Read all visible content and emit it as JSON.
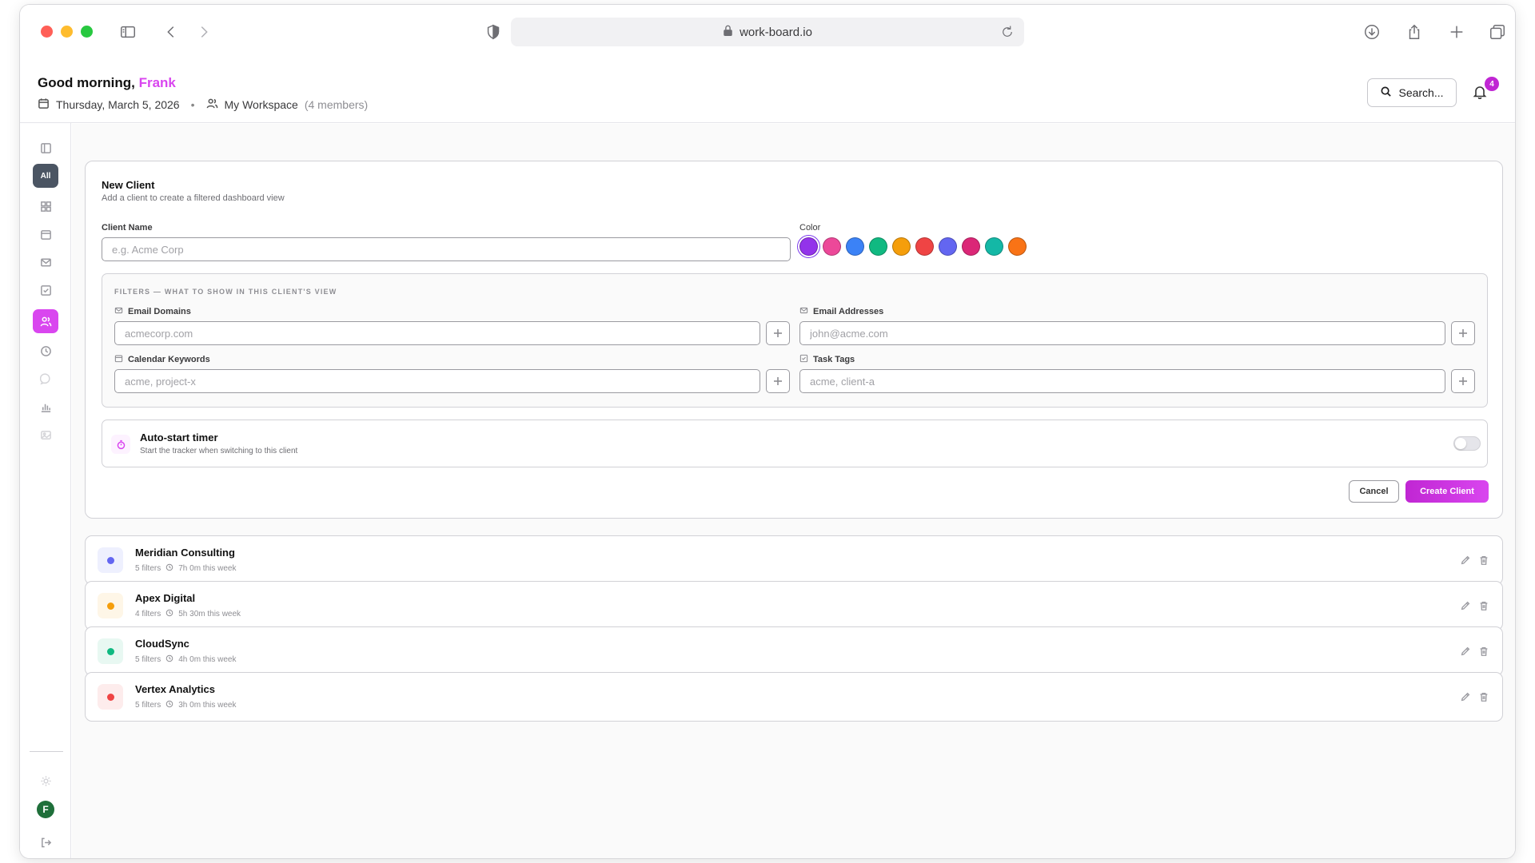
{
  "browser": {
    "url": "work-board.io"
  },
  "header": {
    "greeting": "Good morning,",
    "user_name": "Frank",
    "date": "Thursday, March 5, 2026",
    "separator": "•",
    "workspace": "My Workspace",
    "members": "(4 members)",
    "search_label": "Search...",
    "notification_count": "4"
  },
  "sidebar": {
    "all_label": "All",
    "avatar_initial": "F"
  },
  "new_client": {
    "title": "New Client",
    "subtitle": "Add a client to create a filtered dashboard view",
    "client_name_label": "Client Name",
    "client_name_placeholder": "e.g. Acme Corp",
    "color_label": "Color",
    "colors": [
      "#9333ea",
      "#ec4899",
      "#3b82f6",
      "#10b981",
      "#f59e0b",
      "#ef4444",
      "#6366f1",
      "#db2777",
      "#14b8a6",
      "#f97316"
    ],
    "filters_heading": "FILTERS — WHAT TO SHOW IN THIS CLIENT'S VIEW",
    "email_domains_label": "Email Domains",
    "email_domains_placeholder": "acmecorp.com",
    "email_addresses_label": "Email Addresses",
    "email_addresses_placeholder": "john@acme.com",
    "calendar_keywords_label": "Calendar Keywords",
    "calendar_keywords_placeholder": "acme, project-x",
    "task_tags_label": "Task Tags",
    "task_tags_placeholder": "acme, client-a",
    "autostart_title": "Auto-start timer",
    "autostart_sub": "Start the tracker when switching to this client",
    "cancel_label": "Cancel",
    "create_label": "Create Client"
  },
  "clients": [
    {
      "name": "Meridian Consulting",
      "filters": "5 filters",
      "time": "7h 0m this week",
      "color": "#6366f1",
      "tint": "#eef0fe"
    },
    {
      "name": "Apex Digital",
      "filters": "4 filters",
      "time": "5h 30m this week",
      "color": "#f59e0b",
      "tint": "#fef6e7"
    },
    {
      "name": "CloudSync",
      "filters": "5 filters",
      "time": "4h 0m this week",
      "color": "#10b981",
      "tint": "#e8f8f2"
    },
    {
      "name": "Vertex Analytics",
      "filters": "5 filters",
      "time": "3h 0m this week",
      "color": "#ef4444",
      "tint": "#fdecec"
    }
  ]
}
